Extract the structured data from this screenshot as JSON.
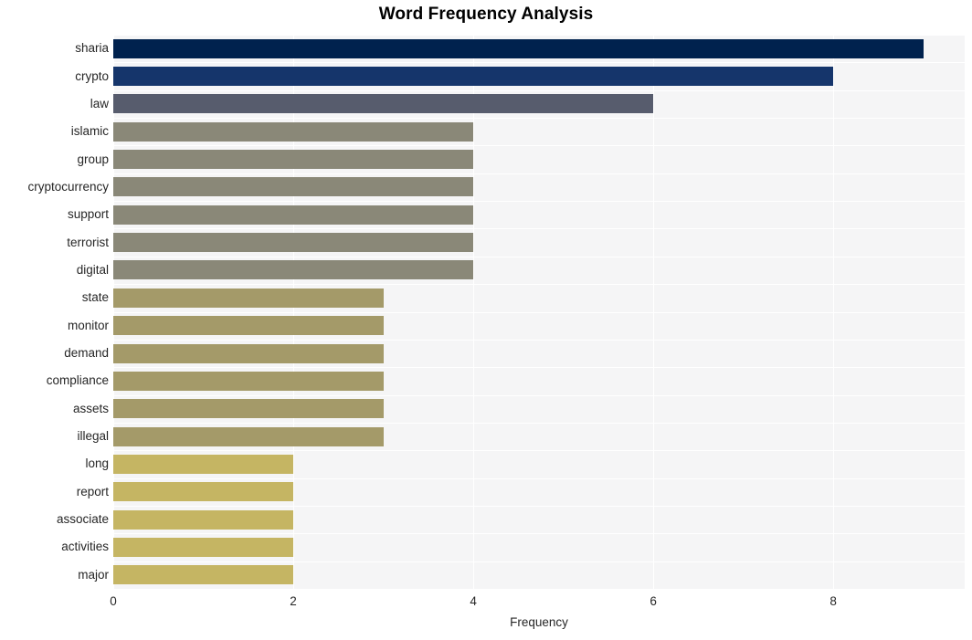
{
  "chart_data": {
    "type": "bar",
    "orientation": "horizontal",
    "title": "Word Frequency Analysis",
    "xlabel": "Frequency",
    "ylabel": "",
    "categories": [
      "sharia",
      "crypto",
      "law",
      "islamic",
      "group",
      "cryptocurrency",
      "support",
      "terrorist",
      "digital",
      "state",
      "monitor",
      "demand",
      "compliance",
      "assets",
      "illegal",
      "long",
      "report",
      "associate",
      "activities",
      "major"
    ],
    "values": [
      9,
      8,
      6,
      4,
      4,
      4,
      4,
      4,
      4,
      3,
      3,
      3,
      3,
      3,
      3,
      2,
      2,
      2,
      2,
      2
    ],
    "bar_colors": [
      "#00224e",
      "#15356b",
      "#575c6d",
      "#8a8878",
      "#8a8878",
      "#8a8878",
      "#8a8878",
      "#8a8878",
      "#8a8878",
      "#a49a69",
      "#a49a69",
      "#a49a69",
      "#a49a69",
      "#a49a69",
      "#a49a69",
      "#c5b563",
      "#c5b563",
      "#c5b563",
      "#c5b563",
      "#c5b563"
    ],
    "xlim": [
      0,
      9.46
    ],
    "xticks": [
      0,
      2,
      4,
      6,
      8
    ],
    "xtick_labels": [
      "0",
      "2",
      "4",
      "6",
      "8"
    ],
    "grid": true,
    "grid_color": "#ffffff",
    "plot_background": "#f5f5f6",
    "figure_background": "#ffffff",
    "legend": null
  }
}
